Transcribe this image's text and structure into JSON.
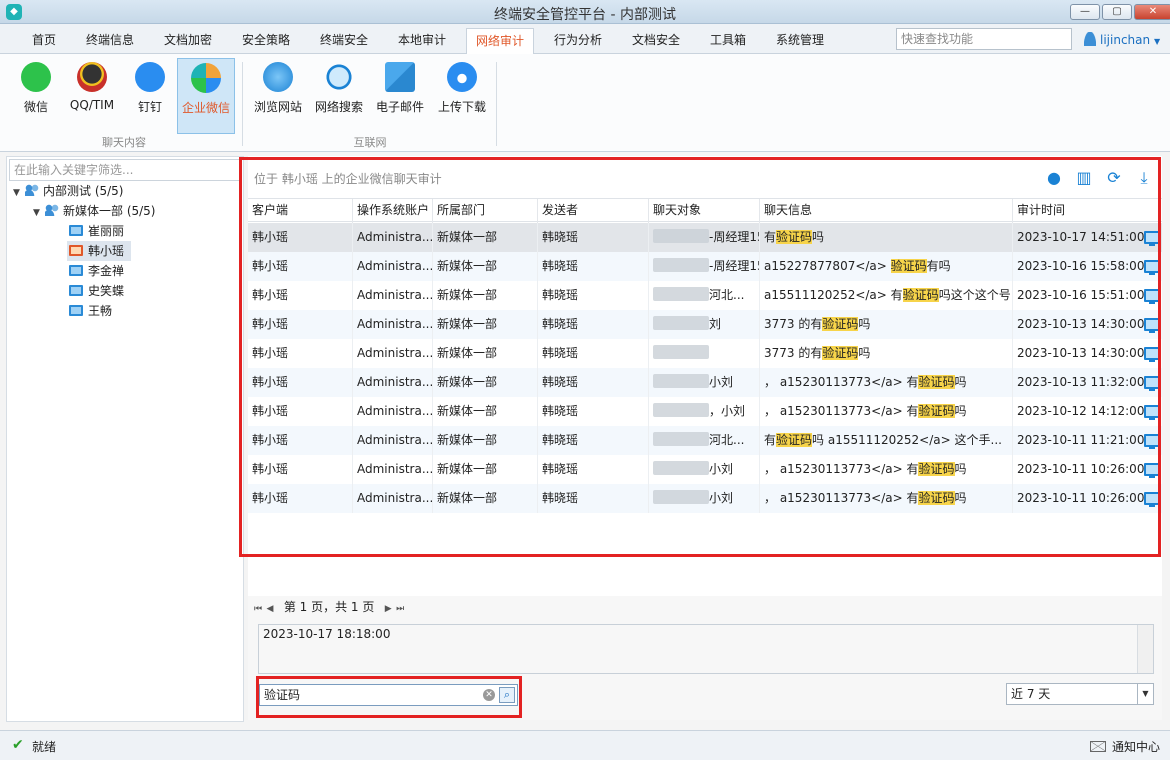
{
  "window": {
    "title": "终端安全管控平台 - 内部测试"
  },
  "menu": {
    "tabs": [
      "首页",
      "终端信息",
      "文档加密",
      "安全策略",
      "终端安全",
      "本地审计",
      "网络审计",
      "行为分析",
      "文档安全",
      "工具箱",
      "系统管理"
    ],
    "active": "网络审计",
    "quick_search_placeholder": "快速查找功能",
    "user": "lijinchan"
  },
  "ribbon": {
    "chat_group": {
      "label": "聊天内容",
      "items": [
        "微信",
        "QQ/TIM",
        "钉钉",
        "企业微信"
      ],
      "active": "企业微信"
    },
    "internet_group": {
      "label": "互联网",
      "items": [
        "浏览网站",
        "网络搜索",
        "电子邮件",
        "上传下载"
      ]
    }
  },
  "sidebar": {
    "filter_placeholder": "在此输入关键字筛选...",
    "root": "内部测试 (5/5)",
    "group": "新媒体一部 (5/5)",
    "users": [
      "崔丽丽",
      "韩小瑶",
      "李金禅",
      "史笑蝶",
      "王畅"
    ],
    "selected": "韩小瑶"
  },
  "grid": {
    "caption": "位于 韩小瑶 上的企业微信聊天审计",
    "columns": [
      "客户端",
      "操作系统账户",
      "所属部门",
      "发送者",
      "聊天对象",
      "聊天信息",
      "审计时间"
    ],
    "rows": [
      {
        "client": "韩小瑶",
        "account": "Administra...",
        "dept": "新媒体一部",
        "sender": "韩晓瑶",
        "peer": "-周经理15...",
        "msg_pre": "有",
        "msg_hl": "验证码",
        "msg_post": "吗",
        "time": "2023-10-17 14:51:00"
      },
      {
        "client": "韩小瑶",
        "account": "Administra...",
        "dept": "新媒体一部",
        "sender": "韩晓瑶",
        "peer": "-周经理15...",
        "msg_pre": "a15227877807</a> ",
        "msg_hl": "验证码",
        "msg_post": "有吗",
        "time": "2023-10-16 15:58:00"
      },
      {
        "client": "韩小瑶",
        "account": "Administra...",
        "dept": "新媒体一部",
        "sender": "韩晓瑶",
        "peer": "河北...",
        "msg_pre": "a15511120252</a>  有",
        "msg_hl": "验证码",
        "msg_post": "吗这个这个号",
        "time": "2023-10-16 15:51:00"
      },
      {
        "client": "韩小瑶",
        "account": "Administra...",
        "dept": "新媒体一部",
        "sender": "韩晓瑶",
        "peer": "刘",
        "msg_pre": "3773 的有",
        "msg_hl": "验证码",
        "msg_post": "吗",
        "time": "2023-10-13 14:30:00"
      },
      {
        "client": "韩小瑶",
        "account": "Administra...",
        "dept": "新媒体一部",
        "sender": "韩晓瑶",
        "peer": "",
        "msg_pre": "3773 的有",
        "msg_hl": "验证码",
        "msg_post": "吗",
        "time": "2023-10-13 14:30:00"
      },
      {
        "client": "韩小瑶",
        "account": "Administra...",
        "dept": "新媒体一部",
        "sender": "韩晓瑶",
        "peer": "小刘",
        "msg_pre": "， a15230113773</a>  有",
        "msg_hl": "验证码",
        "msg_post": "吗",
        "time": "2023-10-13 11:32:00"
      },
      {
        "client": "韩小瑶",
        "account": "Administra...",
        "dept": "新媒体一部",
        "sender": "韩晓瑶",
        "peer": "，小刘",
        "msg_pre": "， a15230113773</a>  有",
        "msg_hl": "验证码",
        "msg_post": "吗",
        "time": "2023-10-12 14:12:00"
      },
      {
        "client": "韩小瑶",
        "account": "Administra...",
        "dept": "新媒体一部",
        "sender": "韩晓瑶",
        "peer": "河北...",
        "msg_pre": "有",
        "msg_hl": "验证码",
        "msg_post": "吗  a15511120252</a> 这个手...",
        "time": "2023-10-11 11:21:00"
      },
      {
        "client": "韩小瑶",
        "account": "Administra...",
        "dept": "新媒体一部",
        "sender": "韩晓瑶",
        "peer": "小刘",
        "msg_pre": "， a15230113773</a>  有",
        "msg_hl": "验证码",
        "msg_post": "吗",
        "time": "2023-10-11 10:26:00"
      },
      {
        "client": "韩小瑶",
        "account": "Administra...",
        "dept": "新媒体一部",
        "sender": "韩晓瑶",
        "peer": "小刘",
        "msg_pre": "， a15230113773</a>  有",
        "msg_hl": "验证码",
        "msg_post": "吗",
        "time": "2023-10-11 10:26:00"
      }
    ]
  },
  "pager": {
    "text": "第 1 页，共 1 页"
  },
  "detail": {
    "text": "2023-10-17 18:18:00"
  },
  "search": {
    "value": "验证码"
  },
  "range": {
    "value": "近 7 天"
  },
  "status": {
    "text": "就绪",
    "notify": "通知中心"
  },
  "colors": {
    "accent": "#e0582a",
    "highlight": "#f7d44a",
    "annotation": "#e32222",
    "icon_blue": "#1a82d4"
  }
}
